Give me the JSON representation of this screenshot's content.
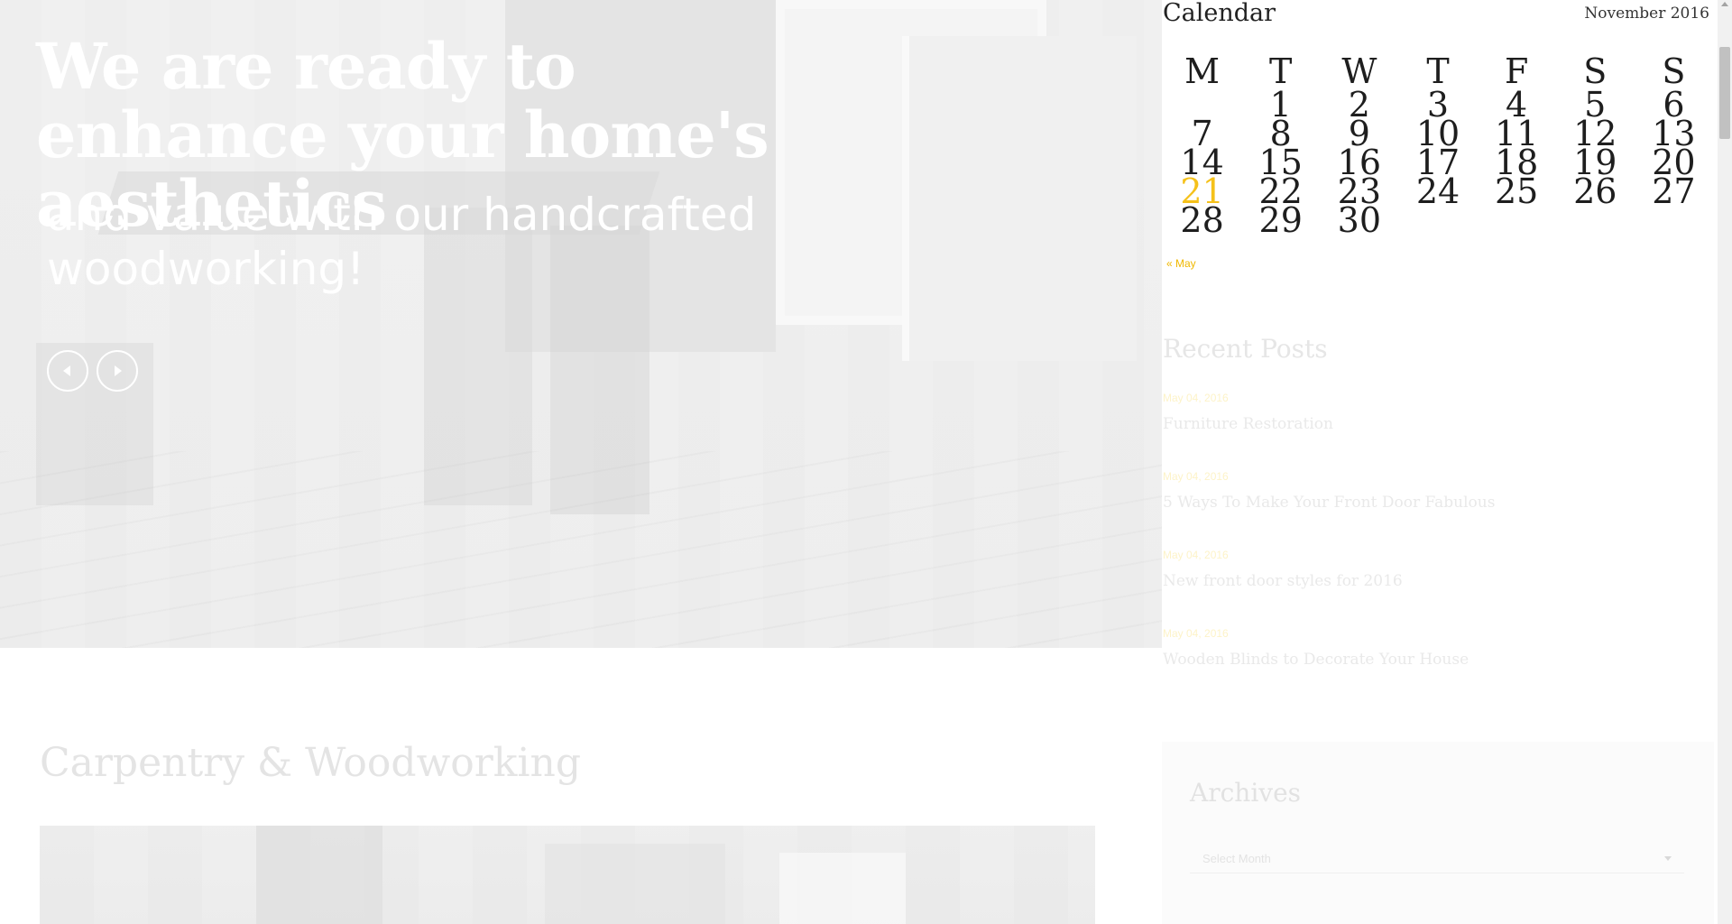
{
  "hero": {
    "title": "We are ready to enhance your home's aesthetics",
    "subtitle": "and value with our handcrafted woodworking!",
    "prev_icon": "chevron-left-icon",
    "next_icon": "chevron-right-icon"
  },
  "main": {
    "section_title": "Carpentry & Woodworking"
  },
  "calendar": {
    "title": "Calendar",
    "month": "November 2016",
    "weekdays": [
      "M",
      "T",
      "W",
      "T",
      "F",
      "S",
      "S"
    ],
    "weeks": [
      [
        "",
        "1",
        "2",
        "3",
        "4",
        "5",
        "6"
      ],
      [
        "7",
        "8",
        "9",
        "10",
        "11",
        "12",
        "13"
      ],
      [
        "14",
        "15",
        "16",
        "17",
        "18",
        "19",
        "20"
      ],
      [
        "21",
        "22",
        "23",
        "24",
        "25",
        "26",
        "27"
      ],
      [
        "28",
        "29",
        "30",
        "",
        "",
        "",
        ""
      ]
    ],
    "today": "21",
    "prev_link": "« May",
    "accent_color": "#f5c11a"
  },
  "recent_posts": {
    "title": "Recent Posts",
    "posts": [
      {
        "date": "May 04, 2016",
        "title": "Furniture Restoration"
      },
      {
        "date": "May 04, 2016",
        "title": "5 Ways To Make Your Front Door Fabulous"
      },
      {
        "date": "May 04, 2016",
        "title": "New front door styles for 2016"
      },
      {
        "date": "May 04, 2016",
        "title": "Wooden Blinds to Decorate Your House"
      }
    ]
  },
  "archives": {
    "title": "Archives",
    "select_placeholder": "Select Month"
  }
}
